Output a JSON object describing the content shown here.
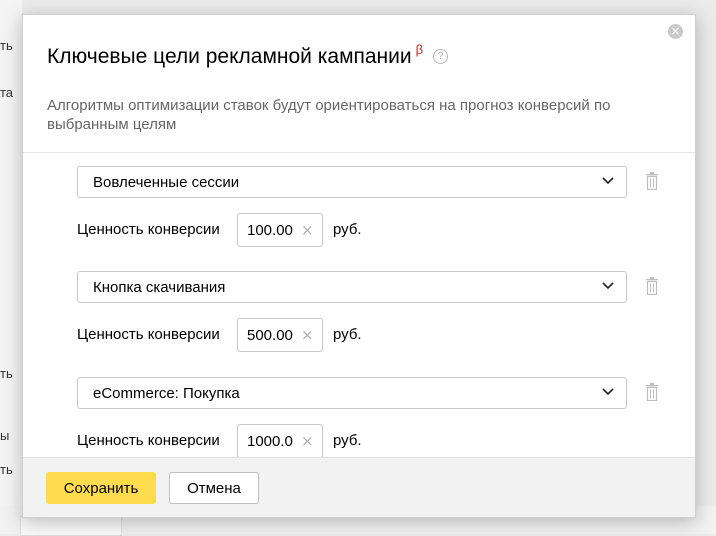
{
  "background": {
    "fragments": [
      "ть",
      "та",
      "ть",
      "ы",
      "ть"
    ]
  },
  "modal": {
    "title": "Ключевые цели рекламной кампании",
    "beta_badge": "β",
    "help_icon": "question-circle-icon",
    "close_icon": "close-circle-icon",
    "subtitle": "Алгоритмы оптимизации ставок будут ориентироваться на прогноз конверсий по выбранным целям",
    "goals": [
      {
        "name": "Вовлеченные сессии",
        "value_label": "Ценность конверсии",
        "value": "100.00",
        "unit": "руб."
      },
      {
        "name": "Кнопка скачивания",
        "value_label": "Ценность конверсии",
        "value": "500.00",
        "unit": "руб."
      },
      {
        "name": "eCommerce: Покупка",
        "value_label": "Ценность конверсии",
        "value": "1000.0",
        "unit": "руб."
      }
    ],
    "clear_glyph": "×",
    "footer": {
      "save_label": "Сохранить",
      "cancel_label": "Отмена"
    }
  },
  "colors": {
    "accent_button": "#ffdb4d",
    "beta": "#e02020",
    "subtitle_text": "#666666"
  }
}
